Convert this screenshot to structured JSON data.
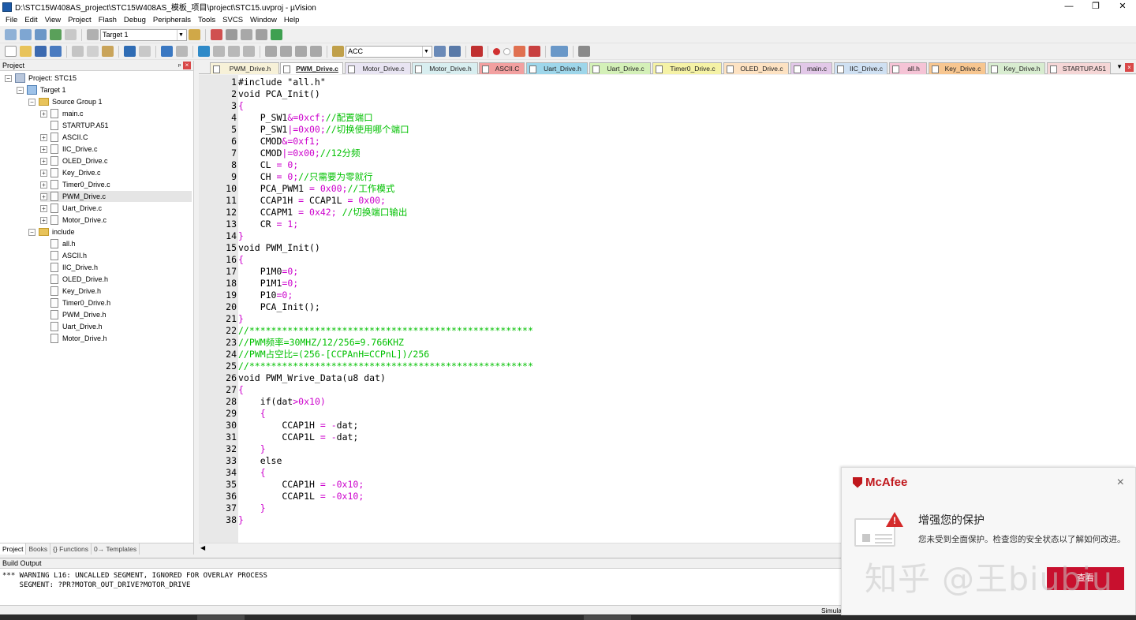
{
  "window": {
    "title": "D:\\STC15W408AS_project\\STC15W408AS_模板_项目\\project\\STC15.uvproj - µVision",
    "controls": [
      "minimize",
      "restore",
      "close"
    ]
  },
  "menu": [
    "File",
    "Edit",
    "View",
    "Project",
    "Flash",
    "Debug",
    "Peripherals",
    "Tools",
    "SVCS",
    "Window",
    "Help"
  ],
  "toolbar": {
    "target": "Target 1",
    "find_text": "ACC"
  },
  "project_pane": {
    "header": "Project",
    "pin": "ᵖ",
    "close": "×",
    "root": "Project: STC15",
    "target": "Target 1",
    "group1": "Source Group 1",
    "sources": [
      "main.c",
      "STARTUP.A51",
      "ASCII.C",
      "IIC_Drive.c",
      "OLED_Drive.c",
      "Key_Drive.c",
      "Timer0_Drive.c",
      "PWM_Drive.c",
      "Uart_Drive.c",
      "Motor_Drive.c"
    ],
    "group2": "include",
    "headers": [
      "all.h",
      "ASCII.h",
      "IIC_Drive.h",
      "OLED_Drive.h",
      "Key_Drive.h",
      "Timer0_Drive.h",
      "PWM_Drive.h",
      "Uart_Drive.h",
      "Motor_Drive.h"
    ],
    "selected": "PWM_Drive.c",
    "tabs": [
      "Project",
      "Books",
      "{} Functions",
      "0→ Templates"
    ]
  },
  "editor_tabs": [
    {
      "label": "PWM_Drive.h",
      "color": "#f7f1d8"
    },
    {
      "label": "PWM_Drive.c",
      "color": "#ffffff",
      "active": true
    },
    {
      "label": "Motor_Drive.c",
      "color": "#e8e4f2"
    },
    {
      "label": "Motor_Drive.h",
      "color": "#d8eef0"
    },
    {
      "label": "ASCII.C",
      "color": "#f2a0a0"
    },
    {
      "label": "Uart_Drive.h",
      "color": "#9ed6ea"
    },
    {
      "label": "Uart_Drive.c",
      "color": "#d4f0b8"
    },
    {
      "label": "Timer0_Drive.c",
      "color": "#f5f2a6"
    },
    {
      "label": "OLED_Drive.c",
      "color": "#fde2c2"
    },
    {
      "label": "main.c",
      "color": "#e2c8e8"
    },
    {
      "label": "IIC_Drive.c",
      "color": "#cfe0f2"
    },
    {
      "label": "all.h",
      "color": "#f5c4d6"
    },
    {
      "label": "Key_Drive.c",
      "color": "#f7c690"
    },
    {
      "label": "Key_Drive.h",
      "color": "#d8ecd0"
    },
    {
      "label": "STARTUP.A51",
      "color": "#f5d6d6"
    }
  ],
  "editor_tab_controls": {
    "menu": "▼",
    "close": "×"
  },
  "code": {
    "line_numbers": [
      "1",
      "2",
      "3",
      "4",
      "5",
      "6",
      "7",
      "8",
      "9",
      "10",
      "11",
      "12",
      "13",
      "14",
      "15",
      "16",
      "17",
      "18",
      "19",
      "20",
      "21",
      "22",
      "23",
      "24",
      "25",
      "26",
      "27",
      "28",
      "29",
      "30",
      "31",
      "32",
      "33",
      "34",
      "35",
      "36",
      "37",
      "38"
    ],
    "lines": [
      [
        [
          "n",
          "#include \"all.h\""
        ]
      ],
      [
        [
          "n",
          "void PCA_Init()"
        ]
      ],
      [
        [
          "o",
          "{"
        ]
      ],
      [
        [
          "n",
          "    P_SW1"
        ],
        [
          "o",
          "&=0xcf;"
        ],
        [
          "c",
          "//配置端口"
        ]
      ],
      [
        [
          "n",
          "    P_SW1"
        ],
        [
          "o",
          "|=0x00;"
        ],
        [
          "c",
          "//切换使用哪个端口"
        ]
      ],
      [
        [
          "n",
          "    CMOD"
        ],
        [
          "o",
          "&=0xf1;"
        ]
      ],
      [
        [
          "n",
          "    CMOD"
        ],
        [
          "o",
          "|=0x00;"
        ],
        [
          "c",
          "//12分频"
        ]
      ],
      [
        [
          "n",
          "    CL "
        ],
        [
          "o",
          "= 0;"
        ]
      ],
      [
        [
          "n",
          "    CH "
        ],
        [
          "o",
          "= 0;"
        ],
        [
          "c",
          "//只需要为零就行"
        ]
      ],
      [
        [
          "n",
          "    PCA_PWM1 "
        ],
        [
          "o",
          "= 0x00;"
        ],
        [
          "c",
          "//工作模式"
        ]
      ],
      [
        [
          "n",
          "    CCAP1H "
        ],
        [
          "o",
          "= "
        ],
        [
          "n",
          "CCAP1L "
        ],
        [
          "o",
          "= 0x00;"
        ]
      ],
      [
        [
          "n",
          "    CCAPM1 "
        ],
        [
          "o",
          "= 0x42; "
        ],
        [
          "c",
          "//切换端口输出"
        ]
      ],
      [
        [
          "n",
          "    CR "
        ],
        [
          "o",
          "= 1;"
        ]
      ],
      [
        [
          "o",
          "}"
        ]
      ],
      [
        [
          "n",
          "void PWM_Init()"
        ]
      ],
      [
        [
          "o",
          "{"
        ]
      ],
      [
        [
          "n",
          "    P1M0"
        ],
        [
          "o",
          "=0;"
        ]
      ],
      [
        [
          "n",
          "    P1M1"
        ],
        [
          "o",
          "=0;"
        ]
      ],
      [
        [
          "n",
          "    P10"
        ],
        [
          "o",
          "=0;"
        ]
      ],
      [
        [
          "n",
          "    PCA_Init();"
        ]
      ],
      [
        [
          "o",
          "}"
        ]
      ],
      [
        [
          "c",
          "//****************************************************"
        ]
      ],
      [
        [
          "c",
          "//PWM频率=30MHZ/12/256=9.766KHZ"
        ]
      ],
      [
        [
          "c",
          "//PWM占空比=(256-[CCPAnH=CCPnL])/256"
        ]
      ],
      [
        [
          "c",
          "//****************************************************"
        ]
      ],
      [
        [
          "n",
          "void PWM_Wrive_Data(u8 dat)"
        ]
      ],
      [
        [
          "o",
          "{"
        ]
      ],
      [
        [
          "n",
          "    if(dat"
        ],
        [
          "o",
          ">0x10)"
        ]
      ],
      [
        [
          "o",
          "    {"
        ]
      ],
      [
        [
          "n",
          "        CCAP1H "
        ],
        [
          "o",
          "= -"
        ],
        [
          "n",
          "dat;"
        ]
      ],
      [
        [
          "n",
          "        CCAP1L "
        ],
        [
          "o",
          "= -"
        ],
        [
          "n",
          "dat;"
        ]
      ],
      [
        [
          "o",
          "    }"
        ]
      ],
      [
        [
          "n",
          "    else"
        ]
      ],
      [
        [
          "o",
          "    {"
        ]
      ],
      [
        [
          "n",
          "        CCAP1H "
        ],
        [
          "o",
          "= -0x10;"
        ]
      ],
      [
        [
          "n",
          "        CCAP1L "
        ],
        [
          "o",
          "= -0x10;"
        ]
      ],
      [
        [
          "o",
          "    }"
        ]
      ],
      [
        [
          "o",
          "}"
        ]
      ]
    ]
  },
  "build_output": {
    "header": "Build Output",
    "lines": [
      "*** WARNING L16: UNCALLED SEGMENT, IGNORED FOR OVERLAY PROCESS",
      "    SEGMENT: ?PR?MOTOR_OUT_DRIVE?MOTOR_DRIVE"
    ]
  },
  "status": {
    "text": "Simula"
  },
  "popup": {
    "brand": "McAfee",
    "close": "×",
    "heading": "增强您的保护",
    "body": "您未受到全面保护。检查您的安全状态以了解如何改进。",
    "button": "查看"
  },
  "watermark": "知乎 @王biubiu",
  "colors": {
    "keyword": "#000000",
    "operator": "#cc00cc",
    "comment": "#00c000",
    "brand": "#c0171c"
  }
}
